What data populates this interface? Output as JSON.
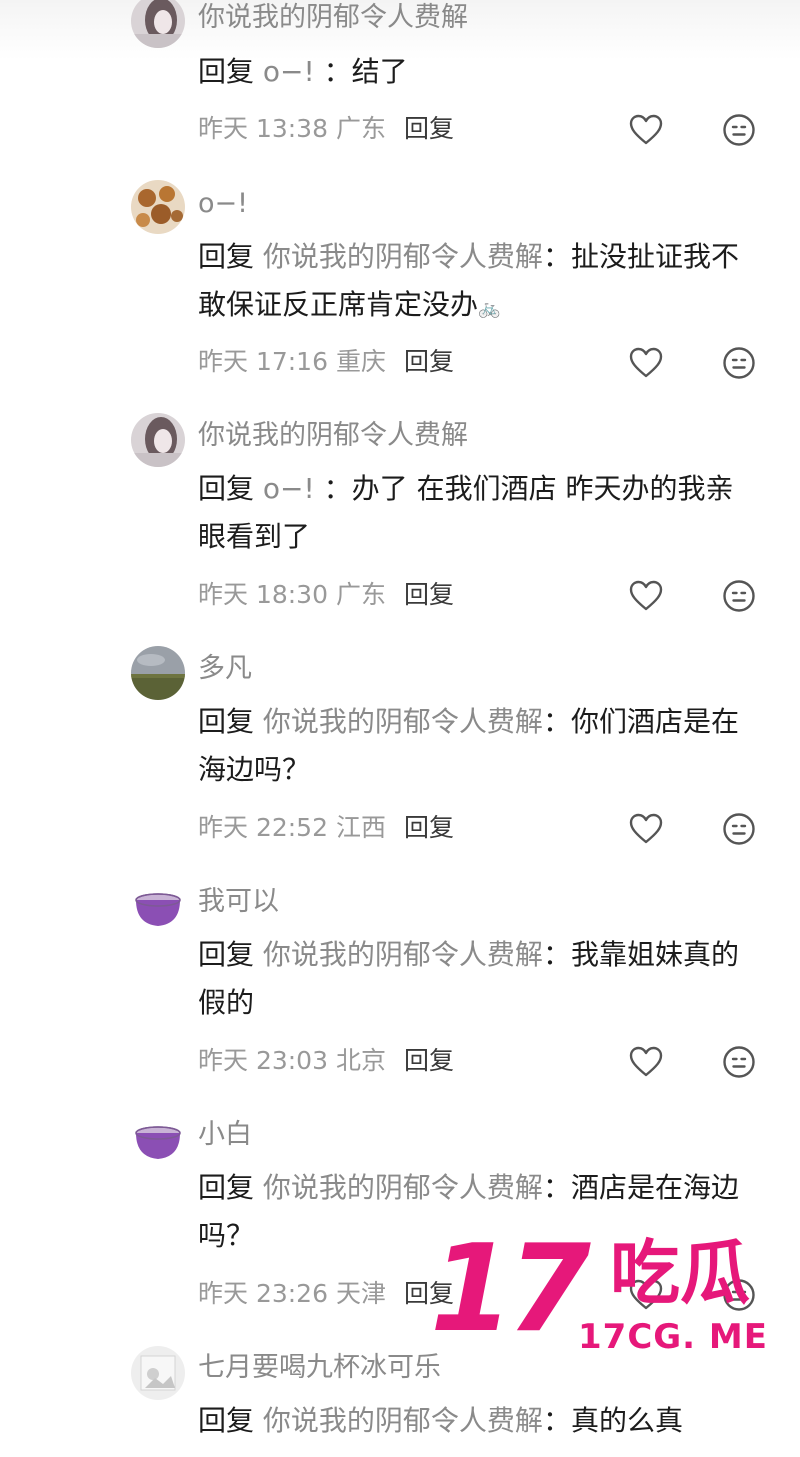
{
  "comments": [
    {
      "username": "你说我的阴郁令人费解",
      "reply_word": "回复",
      "target": "o−!",
      "sep": "：",
      "text": "结了",
      "time": "昨天 13:38 广东",
      "reply_label": "回复",
      "avatar": "avatar-girl"
    },
    {
      "username": "o−!",
      "reply_word": "回复",
      "target": "你说我的阴郁令人费解",
      "sep": "：",
      "text": "扯没扯证我不敢保证反正席肯定没办",
      "time": "昨天 17:16 重庆",
      "reply_label": "回复",
      "avatar": "avatar-cookies"
    },
    {
      "username": "你说我的阴郁令人费解",
      "reply_word": "回复",
      "target": "o−!",
      "sep": "：",
      "text": "办了 在我们酒店 昨天办的我亲眼看到了",
      "time": "昨天 18:30 广东",
      "reply_label": "回复",
      "avatar": "avatar-girl"
    },
    {
      "username": "多凡",
      "reply_word": "回复",
      "target": "你说我的阴郁令人费解",
      "sep": "：",
      "text": "你们酒店是在海边吗？",
      "time": "昨天 22:52 江西",
      "reply_label": "回复",
      "avatar": "avatar-landscape"
    },
    {
      "username": "我可以",
      "reply_word": "回复",
      "target": "你说我的阴郁令人费解",
      "sep": "：",
      "text": "我靠姐妹真的假的",
      "time": "昨天 23:03 北京",
      "reply_label": "回复",
      "avatar": "avatar-bowl"
    },
    {
      "username": "小白",
      "reply_word": "回复",
      "target": "你说我的阴郁令人费解",
      "sep": "：",
      "text": "酒店是在海边吗？",
      "time": "昨天 23:26 天津",
      "reply_label": "回复",
      "avatar": "avatar-bowl"
    },
    {
      "username": "七月要喝九杯冰可乐",
      "reply_word": "回复",
      "target": "你说我的阴郁令人费解",
      "sep": "：",
      "text": "真的么真",
      "avatar": "avatar-photo"
    }
  ],
  "watermark": {
    "number": "17",
    "name": "吃瓜",
    "url": "17CG. ME",
    "color": "#e6187a"
  },
  "icons": {
    "like": "heart-outline-icon",
    "dislike": "neutral-face-icon"
  }
}
